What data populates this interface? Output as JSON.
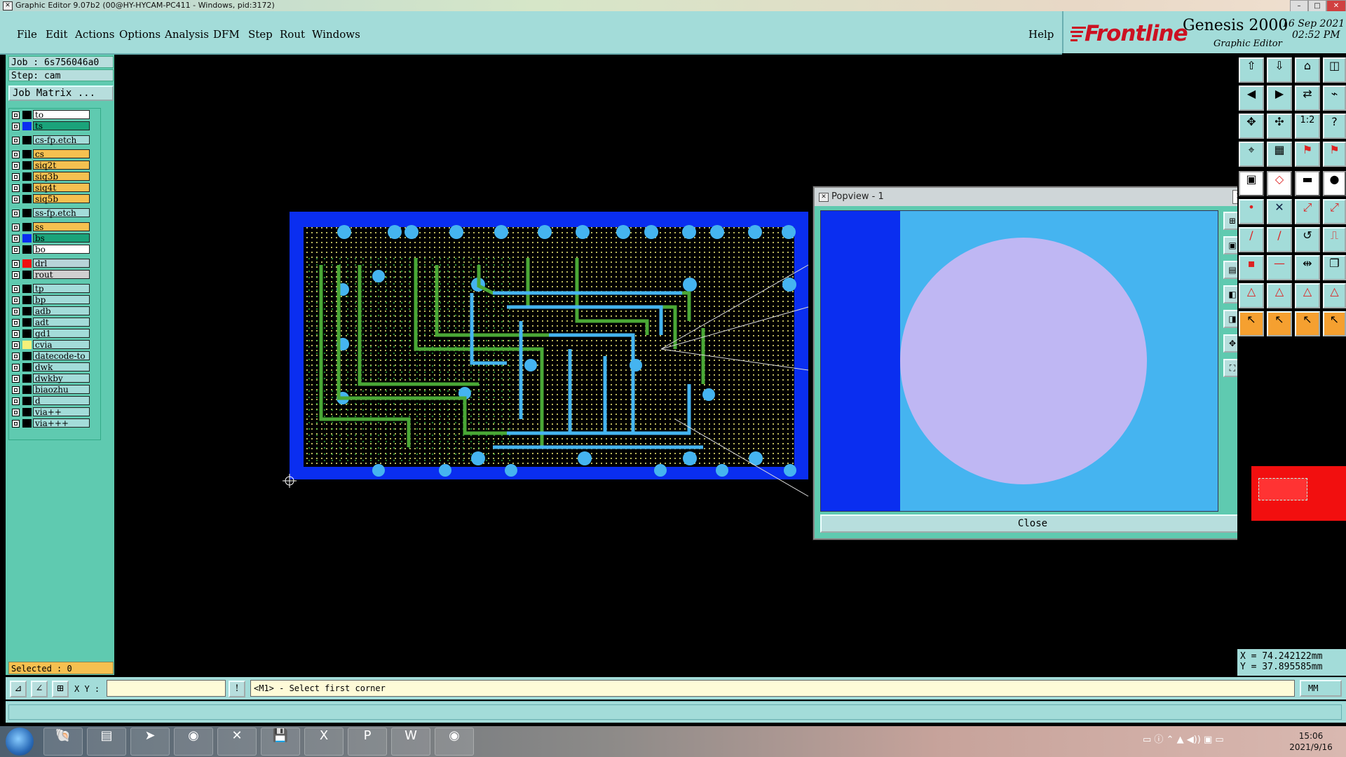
{
  "window": {
    "title": "Graphic Editor 9.07b2 (00@HY-HYCAM-PC411 - Windows, pid:3172)"
  },
  "menu": {
    "items": [
      {
        "label": "File",
        "mnemonic": "F"
      },
      {
        "label": "Edit",
        "mnemonic": "E"
      },
      {
        "label": "Actions",
        "mnemonic": "A"
      },
      {
        "label": "Options",
        "mnemonic": "O"
      },
      {
        "label": "Analysis",
        "mnemonic": "A"
      },
      {
        "label": "DFM",
        "mnemonic": "D"
      },
      {
        "label": "Step",
        "mnemonic": "S"
      },
      {
        "label": "Rout",
        "mnemonic": "R"
      },
      {
        "label": "Windows",
        "mnemonic": "W"
      }
    ],
    "help": "Help"
  },
  "branding": {
    "brand": "Frontline",
    "product": "Genesis 2000",
    "subtitle": "Graphic Editor",
    "date": "16 Sep 2021",
    "time": "02:52 PM"
  },
  "job": {
    "job_line": "Job : 6s756046a0",
    "step_line": "Step: cam",
    "matrix_button": "Job Matrix ..."
  },
  "layers": [
    {
      "name": "to",
      "color": "#ffffff",
      "swatch": "#000000"
    },
    {
      "name": "ts",
      "color": "#1aa37a",
      "swatch": "#0a2ef0"
    },
    {
      "name": "cs-fp.etch",
      "color": "#a3dcd9",
      "swatch": "#000000"
    },
    {
      "name": "cs",
      "color": "#f5c050",
      "swatch": "#000000"
    },
    {
      "name": "siq2t",
      "color": "#f5c050",
      "swatch": "#000000"
    },
    {
      "name": "siq3b",
      "color": "#f5c050",
      "swatch": "#000000"
    },
    {
      "name": "siq4t",
      "color": "#f5c050",
      "swatch": "#000000"
    },
    {
      "name": "siq5b",
      "color": "#f5c050",
      "swatch": "#000000"
    },
    {
      "name": "ss-fp.etch",
      "color": "#a3dcd9",
      "swatch": "#000000"
    },
    {
      "name": "ss",
      "color": "#f5c050",
      "swatch": "#000000"
    },
    {
      "name": "bs",
      "color": "#1aa37a",
      "swatch": "#0a2ef0"
    },
    {
      "name": "bo",
      "color": "#ffffff",
      "swatch": "#000000"
    },
    {
      "name": "drl",
      "color": "#b7d3d8",
      "swatch": "#f01010"
    },
    {
      "name": "rout",
      "color": "#d0d0d0",
      "swatch": "#000000"
    },
    {
      "name": "tp",
      "color": "#a3dcd9",
      "swatch": "#000000"
    },
    {
      "name": "bp",
      "color": "#a3dcd9",
      "swatch": "#000000"
    },
    {
      "name": "adb",
      "color": "#a3dcd9",
      "swatch": "#000000"
    },
    {
      "name": "adt",
      "color": "#a3dcd9",
      "swatch": "#000000"
    },
    {
      "name": "gd1",
      "color": "#a3dcd9",
      "swatch": "#000000"
    },
    {
      "name": "cvia",
      "color": "#a3dcd9",
      "swatch": "#f5f07a"
    },
    {
      "name": "datecode-to",
      "color": "#a3dcd9",
      "swatch": "#000000"
    },
    {
      "name": "dwk",
      "color": "#a3dcd9",
      "swatch": "#000000"
    },
    {
      "name": "dwkby",
      "color": "#a3dcd9",
      "swatch": "#000000"
    },
    {
      "name": "biaozhu",
      "color": "#a3dcd9",
      "swatch": "#000000"
    },
    {
      "name": "d",
      "color": "#a3dcd9",
      "swatch": "#000000"
    },
    {
      "name": "via++",
      "color": "#a3dcd9",
      "swatch": "#000000"
    },
    {
      "name": "via+++",
      "color": "#a3dcd9",
      "swatch": "#000000"
    }
  ],
  "selected": "Selected : 0",
  "popview": {
    "title": "Popview - 1",
    "close_x": "✕",
    "close_button": "Close"
  },
  "coords": {
    "x_line": "X = 74.242122mm",
    "y_line": "Y = 37.895585mm"
  },
  "command": {
    "xy_label": "X Y :",
    "xy_value": "",
    "bang": "!",
    "message": "<M1> - Select first corner",
    "unit": "MM"
  },
  "taskbar": {
    "clock_time": "15:06",
    "clock_date": "2021/9/16"
  }
}
